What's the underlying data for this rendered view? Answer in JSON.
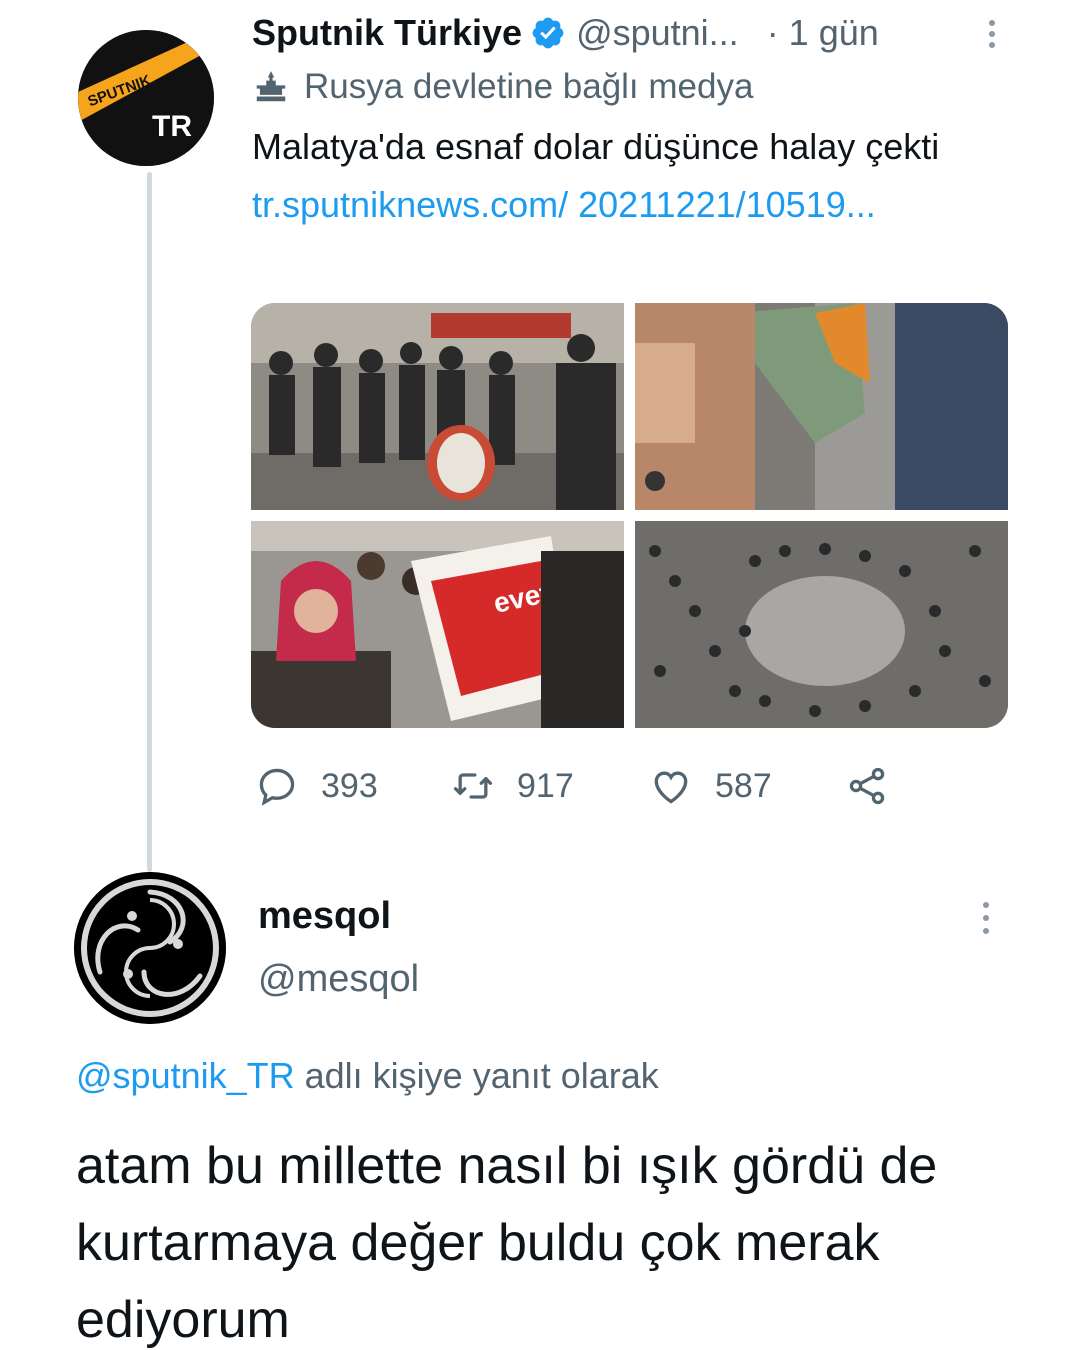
{
  "tweet": {
    "author": {
      "display_name": "Sputnik Türkiye",
      "handle": "@sputni...",
      "avatar_text_top": "SPUTNIK",
      "avatar_text_bottom": "TR",
      "verified": true
    },
    "time": "· 1 gün",
    "label": "Rusya devletine bağlı medya",
    "text": "Malatya'da esnaf dolar düşünce halay çekti ",
    "link": "tr.sputniknews.com/ 20211221/10519...",
    "media_poster_text": "evet",
    "stats": {
      "replies": "393",
      "retweets": "917",
      "likes": "587"
    }
  },
  "reply": {
    "display_name": "mesqol",
    "handle": "@mesqol",
    "context_mention": "@sputnik_TR",
    "context_suffix": " adlı kişiye yanıt olarak",
    "text": "atam bu millette nasıl bi ışık gördü de kurtarmaya değer buldu çok merak ediyorum"
  },
  "colors": {
    "link": "#1d9bf0",
    "secondary_text": "#536471",
    "sputnik_orange": "#f7a41d"
  }
}
